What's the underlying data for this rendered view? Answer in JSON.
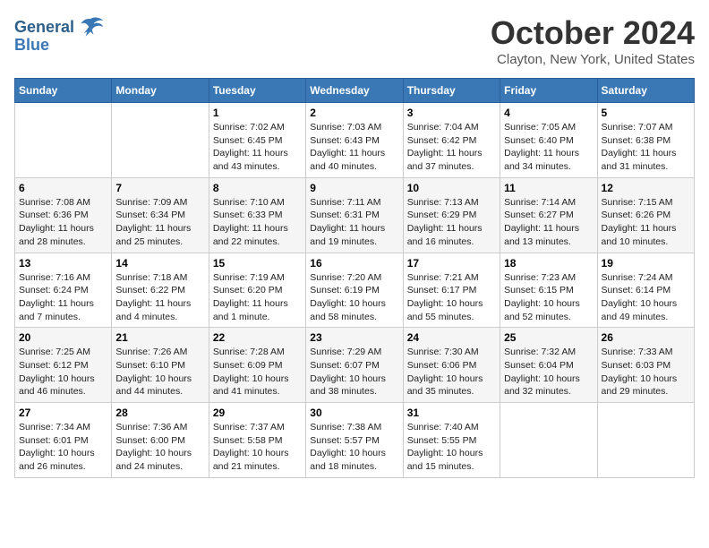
{
  "header": {
    "logo_line1": "General",
    "logo_line2": "Blue",
    "month": "October 2024",
    "location": "Clayton, New York, United States"
  },
  "days_of_week": [
    "Sunday",
    "Monday",
    "Tuesday",
    "Wednesday",
    "Thursday",
    "Friday",
    "Saturday"
  ],
  "weeks": [
    [
      {
        "day": "",
        "sunrise": "",
        "sunset": "",
        "daylight": ""
      },
      {
        "day": "",
        "sunrise": "",
        "sunset": "",
        "daylight": ""
      },
      {
        "day": "1",
        "sunrise": "Sunrise: 7:02 AM",
        "sunset": "Sunset: 6:45 PM",
        "daylight": "Daylight: 11 hours and 43 minutes."
      },
      {
        "day": "2",
        "sunrise": "Sunrise: 7:03 AM",
        "sunset": "Sunset: 6:43 PM",
        "daylight": "Daylight: 11 hours and 40 minutes."
      },
      {
        "day": "3",
        "sunrise": "Sunrise: 7:04 AM",
        "sunset": "Sunset: 6:42 PM",
        "daylight": "Daylight: 11 hours and 37 minutes."
      },
      {
        "day": "4",
        "sunrise": "Sunrise: 7:05 AM",
        "sunset": "Sunset: 6:40 PM",
        "daylight": "Daylight: 11 hours and 34 minutes."
      },
      {
        "day": "5",
        "sunrise": "Sunrise: 7:07 AM",
        "sunset": "Sunset: 6:38 PM",
        "daylight": "Daylight: 11 hours and 31 minutes."
      }
    ],
    [
      {
        "day": "6",
        "sunrise": "Sunrise: 7:08 AM",
        "sunset": "Sunset: 6:36 PM",
        "daylight": "Daylight: 11 hours and 28 minutes."
      },
      {
        "day": "7",
        "sunrise": "Sunrise: 7:09 AM",
        "sunset": "Sunset: 6:34 PM",
        "daylight": "Daylight: 11 hours and 25 minutes."
      },
      {
        "day": "8",
        "sunrise": "Sunrise: 7:10 AM",
        "sunset": "Sunset: 6:33 PM",
        "daylight": "Daylight: 11 hours and 22 minutes."
      },
      {
        "day": "9",
        "sunrise": "Sunrise: 7:11 AM",
        "sunset": "Sunset: 6:31 PM",
        "daylight": "Daylight: 11 hours and 19 minutes."
      },
      {
        "day": "10",
        "sunrise": "Sunrise: 7:13 AM",
        "sunset": "Sunset: 6:29 PM",
        "daylight": "Daylight: 11 hours and 16 minutes."
      },
      {
        "day": "11",
        "sunrise": "Sunrise: 7:14 AM",
        "sunset": "Sunset: 6:27 PM",
        "daylight": "Daylight: 11 hours and 13 minutes."
      },
      {
        "day": "12",
        "sunrise": "Sunrise: 7:15 AM",
        "sunset": "Sunset: 6:26 PM",
        "daylight": "Daylight: 11 hours and 10 minutes."
      }
    ],
    [
      {
        "day": "13",
        "sunrise": "Sunrise: 7:16 AM",
        "sunset": "Sunset: 6:24 PM",
        "daylight": "Daylight: 11 hours and 7 minutes."
      },
      {
        "day": "14",
        "sunrise": "Sunrise: 7:18 AM",
        "sunset": "Sunset: 6:22 PM",
        "daylight": "Daylight: 11 hours and 4 minutes."
      },
      {
        "day": "15",
        "sunrise": "Sunrise: 7:19 AM",
        "sunset": "Sunset: 6:20 PM",
        "daylight": "Daylight: 11 hours and 1 minute."
      },
      {
        "day": "16",
        "sunrise": "Sunrise: 7:20 AM",
        "sunset": "Sunset: 6:19 PM",
        "daylight": "Daylight: 10 hours and 58 minutes."
      },
      {
        "day": "17",
        "sunrise": "Sunrise: 7:21 AM",
        "sunset": "Sunset: 6:17 PM",
        "daylight": "Daylight: 10 hours and 55 minutes."
      },
      {
        "day": "18",
        "sunrise": "Sunrise: 7:23 AM",
        "sunset": "Sunset: 6:15 PM",
        "daylight": "Daylight: 10 hours and 52 minutes."
      },
      {
        "day": "19",
        "sunrise": "Sunrise: 7:24 AM",
        "sunset": "Sunset: 6:14 PM",
        "daylight": "Daylight: 10 hours and 49 minutes."
      }
    ],
    [
      {
        "day": "20",
        "sunrise": "Sunrise: 7:25 AM",
        "sunset": "Sunset: 6:12 PM",
        "daylight": "Daylight: 10 hours and 46 minutes."
      },
      {
        "day": "21",
        "sunrise": "Sunrise: 7:26 AM",
        "sunset": "Sunset: 6:10 PM",
        "daylight": "Daylight: 10 hours and 44 minutes."
      },
      {
        "day": "22",
        "sunrise": "Sunrise: 7:28 AM",
        "sunset": "Sunset: 6:09 PM",
        "daylight": "Daylight: 10 hours and 41 minutes."
      },
      {
        "day": "23",
        "sunrise": "Sunrise: 7:29 AM",
        "sunset": "Sunset: 6:07 PM",
        "daylight": "Daylight: 10 hours and 38 minutes."
      },
      {
        "day": "24",
        "sunrise": "Sunrise: 7:30 AM",
        "sunset": "Sunset: 6:06 PM",
        "daylight": "Daylight: 10 hours and 35 minutes."
      },
      {
        "day": "25",
        "sunrise": "Sunrise: 7:32 AM",
        "sunset": "Sunset: 6:04 PM",
        "daylight": "Daylight: 10 hours and 32 minutes."
      },
      {
        "day": "26",
        "sunrise": "Sunrise: 7:33 AM",
        "sunset": "Sunset: 6:03 PM",
        "daylight": "Daylight: 10 hours and 29 minutes."
      }
    ],
    [
      {
        "day": "27",
        "sunrise": "Sunrise: 7:34 AM",
        "sunset": "Sunset: 6:01 PM",
        "daylight": "Daylight: 10 hours and 26 minutes."
      },
      {
        "day": "28",
        "sunrise": "Sunrise: 7:36 AM",
        "sunset": "Sunset: 6:00 PM",
        "daylight": "Daylight: 10 hours and 24 minutes."
      },
      {
        "day": "29",
        "sunrise": "Sunrise: 7:37 AM",
        "sunset": "Sunset: 5:58 PM",
        "daylight": "Daylight: 10 hours and 21 minutes."
      },
      {
        "day": "30",
        "sunrise": "Sunrise: 7:38 AM",
        "sunset": "Sunset: 5:57 PM",
        "daylight": "Daylight: 10 hours and 18 minutes."
      },
      {
        "day": "31",
        "sunrise": "Sunrise: 7:40 AM",
        "sunset": "Sunset: 5:55 PM",
        "daylight": "Daylight: 10 hours and 15 minutes."
      },
      {
        "day": "",
        "sunrise": "",
        "sunset": "",
        "daylight": ""
      },
      {
        "day": "",
        "sunrise": "",
        "sunset": "",
        "daylight": ""
      }
    ]
  ]
}
